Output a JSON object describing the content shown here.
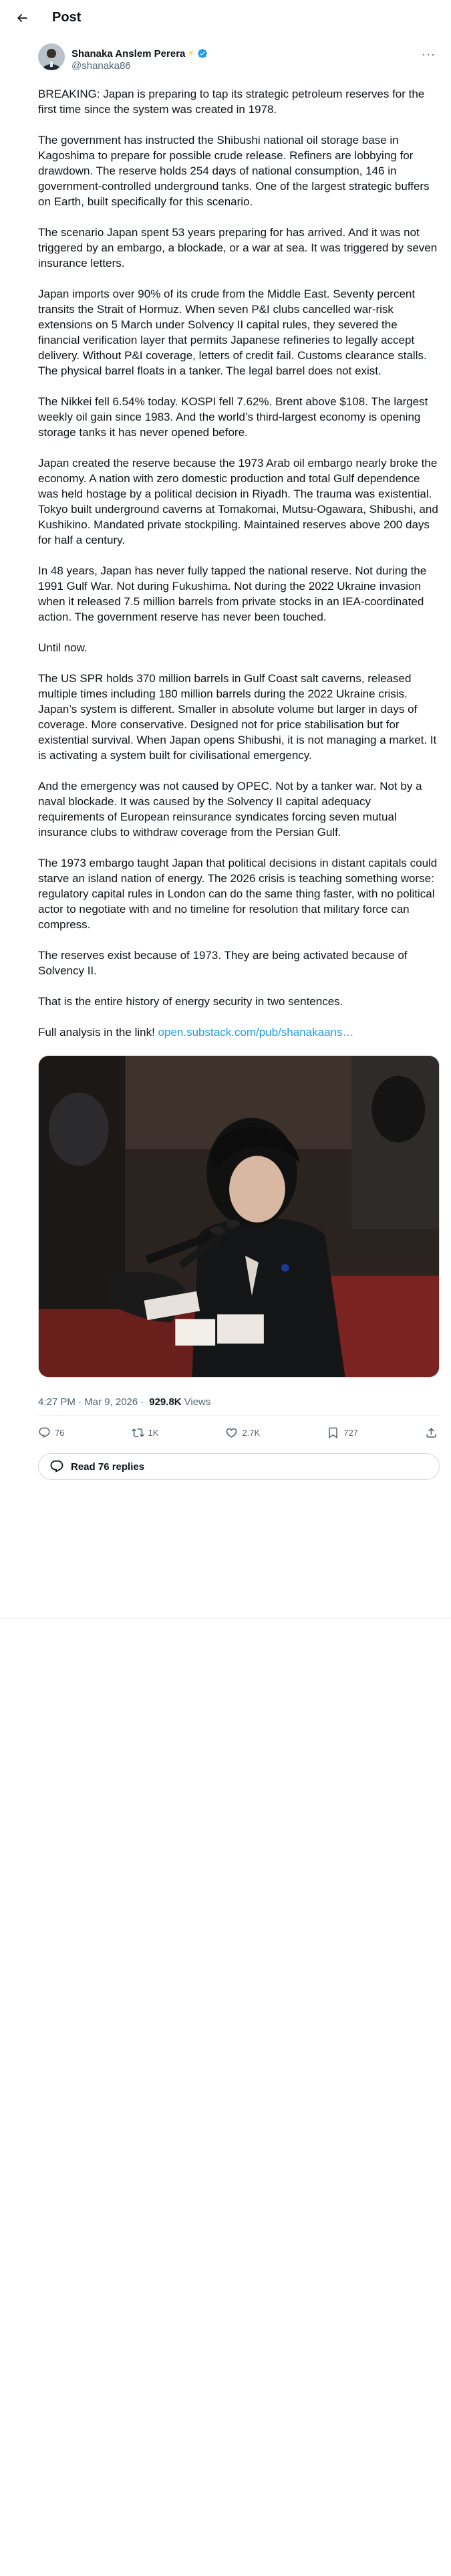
{
  "header": {
    "title": "Post"
  },
  "author": {
    "name": "Shanaka Anslem Perera",
    "name_emoji": "⚡",
    "handle": "@shanaka86"
  },
  "tweet": {
    "paragraphs": [
      "BREAKING: Japan is preparing to tap its strategic petroleum reserves for the first time since the system was created in 1978.",
      "The government has instructed the Shibushi national oil storage base in Kagoshima to prepare for possible crude release. Refiners are lobbying for drawdown. The reserve holds 254 days of national consumption, 146 in government-controlled underground tanks. One of the largest strategic buffers on Earth, built specifically for this scenario.",
      "The scenario Japan spent 53 years preparing for has arrived. And it was not triggered by an embargo, a blockade, or a war at sea. It was triggered by seven insurance letters.",
      "Japan imports over 90% of its crude from the Middle East. Seventy percent transits the Strait of Hormuz. When seven P&I clubs cancelled war-risk extensions on 5 March under Solvency II capital rules, they severed the financial verification layer that permits Japanese refineries to legally accept delivery. Without P&I coverage, letters of credit fail. Customs clearance stalls. The physical barrel floats in a tanker. The legal barrel does not exist.",
      "The Nikkei fell 6.54% today. KOSPI fell 7.62%. Brent above $108. The largest weekly oil gain since 1983. And the world’s third-largest economy is opening storage tanks it has never opened before.",
      "Japan created the reserve because the 1973 Arab oil embargo nearly broke the economy. A nation with zero domestic production and total Gulf dependence was held hostage by a political decision in Riyadh. The trauma was existential. Tokyo built underground caverns at Tomakomai, Mutsu-Ogawara, Shibushi, and Kushikino. Mandated private stockpiling. Maintained reserves above 200 days for half a century.",
      "In 48 years, Japan has never fully tapped the national reserve. Not during the 1991 Gulf War. Not during Fukushima. Not during the 2022 Ukraine invasion when it released 7.5 million barrels from private stocks in an IEA-coordinated action. The government reserve has never been touched.",
      "Until now.",
      "The US SPR holds 370 million barrels in Gulf Coast salt caverns, released multiple times including 180 million barrels during the 2022 Ukraine crisis. Japan’s system is different. Smaller in absolute volume but larger in days of coverage. More conservative. Designed not for price stabilisation but for existential survival. When Japan opens Shibushi, it is not managing a market. It is activating a system built for civilisational emergency.",
      "And the emergency was not caused by OPEC. Not by a tanker war. Not by a naval blockade. It was caused by the Solvency II capital adequacy requirements of European reinsurance syndicates forcing seven mutual insurance clubs to withdraw coverage from the Persian Gulf.",
      "The 1973 embargo taught Japan that political decisions in distant capitals could starve an island nation of energy. The 2026 crisis is teaching something worse: regulatory capital rules in London can do the same thing faster, with no political actor to negotiate with and no timeline for resolution that military force can compress.",
      "The reserves exist because of 1973. They are being activated because of Solvency II.",
      "That is the entire history of energy security in two sentences."
    ],
    "link_prefix": "Full analysis in the link! ",
    "link_text": "open.substack.com/pub/shanakaans…",
    "time": "4:27 PM · Mar 9, 2026",
    "views_count": "929.8K",
    "views_label": "Views"
  },
  "actions": {
    "replies": "76",
    "reposts": "1K",
    "likes": "2.7K",
    "bookmarks": "727"
  },
  "read_replies": "Read 76 replies",
  "icons": [
    "back-arrow-icon",
    "verified-badge-icon",
    "more-icon",
    "reply-icon",
    "repost-icon",
    "like-icon",
    "bookmark-icon",
    "share-icon",
    "speech-bubble-icon"
  ],
  "colors": {
    "accent": "#1d9bf0",
    "text": "#0f1419",
    "muted": "#536471"
  }
}
